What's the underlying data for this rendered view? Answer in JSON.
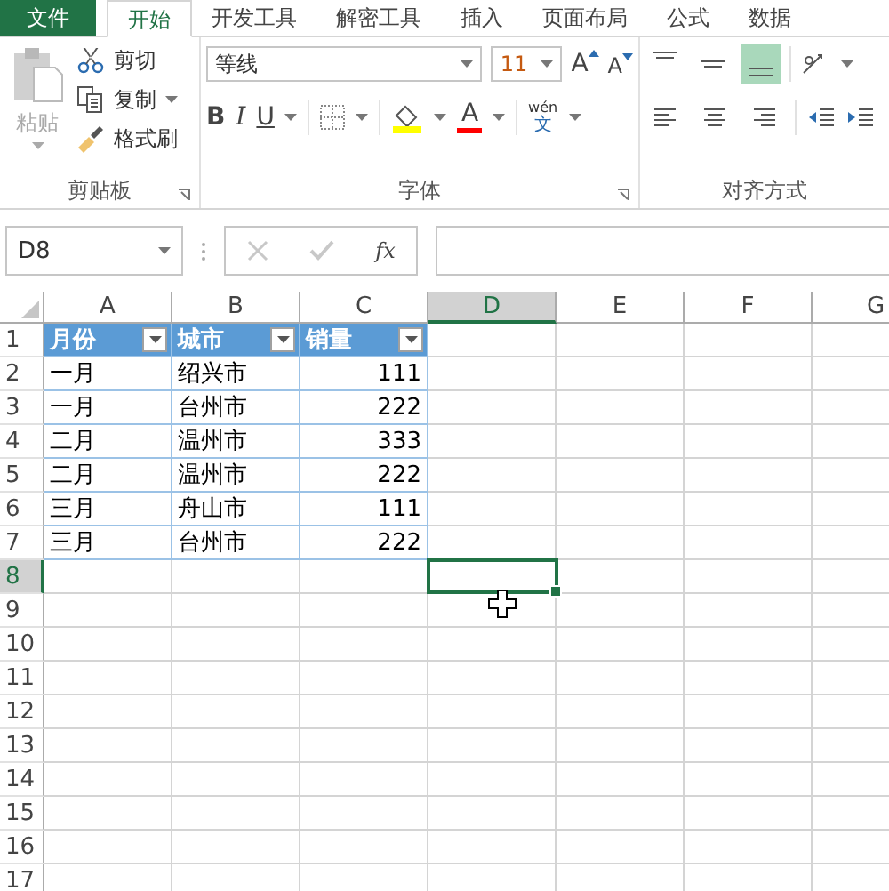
{
  "tabs": [
    {
      "label": "文件",
      "kind": "file",
      "selected": false
    },
    {
      "label": "开始",
      "kind": "tab",
      "selected": true
    },
    {
      "label": "开发工具",
      "kind": "tab",
      "selected": false
    },
    {
      "label": "解密工具",
      "kind": "tab",
      "selected": false
    },
    {
      "label": "插入",
      "kind": "tab",
      "selected": false
    },
    {
      "label": "页面布局",
      "kind": "tab",
      "selected": false
    },
    {
      "label": "公式",
      "kind": "tab",
      "selected": false
    },
    {
      "label": "数据",
      "kind": "tab",
      "selected": false
    }
  ],
  "clipboard": {
    "paste": {
      "label": "粘贴",
      "disabled": true
    },
    "cut": "剪切",
    "copy": "复制",
    "format_painter": "格式刷",
    "label": "剪贴板"
  },
  "font": {
    "name": "等线",
    "size": "11",
    "grow": "A",
    "shrink": "A",
    "bold": "B",
    "italic": "I",
    "underline": "U",
    "font_color": "A",
    "phonetic_top": "wén",
    "phonetic_bottom": "文",
    "label": "字体"
  },
  "alignment": {
    "vertical": [
      {
        "kind": "top",
        "selected": false
      },
      {
        "kind": "middle",
        "selected": false
      },
      {
        "kind": "bottom",
        "selected": true
      }
    ],
    "horizontal": [
      {
        "kind": "left"
      },
      {
        "kind": "center"
      },
      {
        "kind": "right"
      }
    ],
    "label": "对齐方式"
  },
  "name_box": "D8",
  "insert_function": "fx",
  "columns": [
    {
      "label": "A",
      "selected": false
    },
    {
      "label": "B",
      "selected": false
    },
    {
      "label": "C",
      "selected": false
    },
    {
      "label": "D",
      "selected": true
    },
    {
      "label": "E",
      "selected": false
    },
    {
      "label": "F",
      "selected": false
    },
    {
      "label": "G",
      "selected": false
    }
  ],
  "rows": [
    {
      "label": "1",
      "selected": false,
      "cells": [
        {
          "kind": "header",
          "text": "月份"
        },
        {
          "kind": "header",
          "text": "城市"
        },
        {
          "kind": "header",
          "text": "销量"
        }
      ]
    },
    {
      "label": "2",
      "selected": false,
      "cells": [
        {
          "kind": "text",
          "text": "一月"
        },
        {
          "kind": "text",
          "text": "绍兴市"
        },
        {
          "kind": "number",
          "text": "111"
        }
      ]
    },
    {
      "label": "3",
      "selected": false,
      "cells": [
        {
          "kind": "text",
          "text": "一月"
        },
        {
          "kind": "text",
          "text": "台州市"
        },
        {
          "kind": "number",
          "text": "222"
        }
      ]
    },
    {
      "label": "4",
      "selected": false,
      "cells": [
        {
          "kind": "text",
          "text": "二月"
        },
        {
          "kind": "text",
          "text": "温州市"
        },
        {
          "kind": "number",
          "text": "333"
        }
      ]
    },
    {
      "label": "5",
      "selected": false,
      "cells": [
        {
          "kind": "text",
          "text": "二月"
        },
        {
          "kind": "text",
          "text": "温州市"
        },
        {
          "kind": "number",
          "text": "222"
        }
      ]
    },
    {
      "label": "6",
      "selected": false,
      "cells": [
        {
          "kind": "text",
          "text": "三月"
        },
        {
          "kind": "text",
          "text": "舟山市"
        },
        {
          "kind": "number",
          "text": "111"
        }
      ]
    },
    {
      "label": "7",
      "selected": false,
      "cells": [
        {
          "kind": "text",
          "text": "三月"
        },
        {
          "kind": "text",
          "text": "台州市"
        },
        {
          "kind": "number",
          "text": "222"
        }
      ]
    },
    {
      "label": "8",
      "selected": true,
      "cells": []
    },
    {
      "label": "9",
      "selected": false,
      "cells": []
    },
    {
      "label": "10",
      "selected": false,
      "cells": []
    },
    {
      "label": "11",
      "selected": false,
      "cells": []
    },
    {
      "label": "12",
      "selected": false,
      "cells": []
    },
    {
      "label": "13",
      "selected": false,
      "cells": []
    },
    {
      "label": "14",
      "selected": false,
      "cells": []
    },
    {
      "label": "15",
      "selected": false,
      "cells": []
    },
    {
      "label": "16",
      "selected": false,
      "cells": []
    },
    {
      "label": "17",
      "selected": false,
      "cells": []
    }
  ]
}
